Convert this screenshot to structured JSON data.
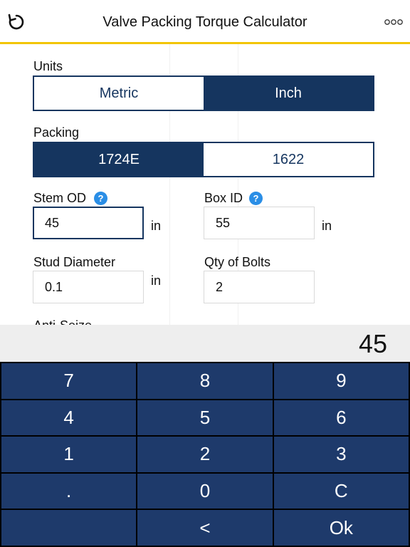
{
  "header": {
    "title": "Valve Packing Torque Calculator",
    "refresh_icon": "refresh-icon",
    "more_icon": "more-dots-icon"
  },
  "units": {
    "label": "Units",
    "options": [
      "Metric",
      "Inch"
    ],
    "selected": "Inch"
  },
  "packing": {
    "label": "Packing",
    "options": [
      "1724E",
      "1622"
    ],
    "selected": "1724E"
  },
  "stem_od": {
    "label": "Stem OD",
    "help": "?",
    "value": "45",
    "unit": "in"
  },
  "box_id": {
    "label": "Box ID",
    "help": "?",
    "value": "55",
    "unit": "in"
  },
  "stud_diameter": {
    "label": "Stud Diameter",
    "value": "0.1",
    "unit": "in"
  },
  "qty_bolts": {
    "label": "Qty of Bolts",
    "value": "2"
  },
  "anti_seize": {
    "label": "Anti-Seize"
  },
  "keypad": {
    "display": "45",
    "keys": [
      "7",
      "8",
      "9",
      "4",
      "5",
      "6",
      "1",
      "2",
      "3",
      ".",
      "0",
      "C",
      "",
      "<",
      "Ok"
    ]
  },
  "colors": {
    "navy": "#15355f",
    "key_bg": "#1e3a6b",
    "accent_yellow": "#f2c500",
    "help_blue": "#2a8ee6"
  }
}
